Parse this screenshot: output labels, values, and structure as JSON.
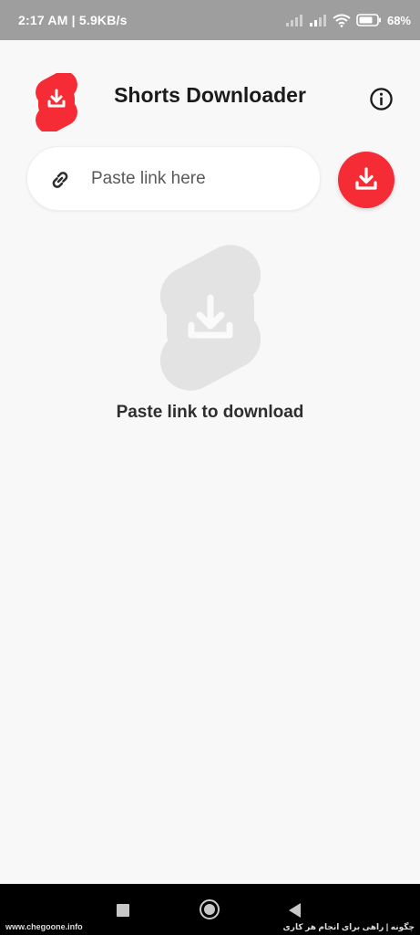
{
  "status_bar": {
    "time": "2:17 AM",
    "separator": " | ",
    "speed": "5.9KB/s",
    "battery": "68%"
  },
  "app": {
    "title": "Shorts Downloader",
    "brand_color": "#f52b35"
  },
  "search": {
    "placeholder": "Paste link here",
    "value": ""
  },
  "empty_state": {
    "message": "Paste link to download"
  },
  "icons": {
    "logo": "shorts-download-logo-icon",
    "info": "info-icon",
    "link": "link-icon",
    "download": "download-icon",
    "illustration": "shorts-download-placeholder-icon"
  },
  "watermark": {
    "left": "www.chegoone.info",
    "right": "چگونه | راهی برای انجام هر کاری"
  }
}
